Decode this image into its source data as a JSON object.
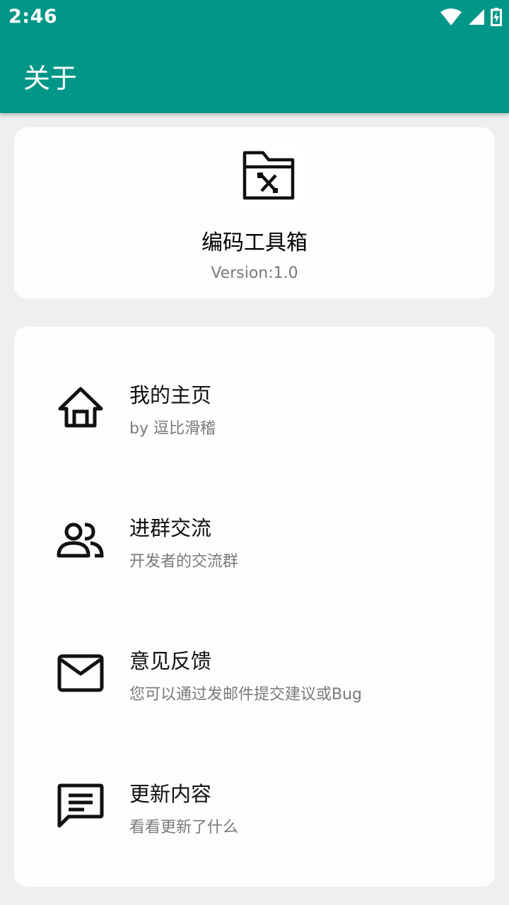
{
  "status_bar": {
    "time": "2:46",
    "icons": [
      "wifi-icon",
      "cell-signal-icon",
      "battery-charging-icon"
    ]
  },
  "app_bar": {
    "title": "关于",
    "color": "#009688"
  },
  "app_info": {
    "icon": "toolbox-folder-icon",
    "name": "编码工具箱",
    "version": "Version:1.0"
  },
  "menu": {
    "items": [
      {
        "icon": "home-icon",
        "title": "我的主页",
        "subtitle": "by 逗比滑稽"
      },
      {
        "icon": "group-icon",
        "title": "进群交流",
        "subtitle": "开发者的交流群"
      },
      {
        "icon": "mail-icon",
        "title": "意见反馈",
        "subtitle": "您可以通过发邮件提交建议或Bug"
      },
      {
        "icon": "chat-icon",
        "title": "更新内容",
        "subtitle": "看看更新了什么"
      }
    ]
  }
}
